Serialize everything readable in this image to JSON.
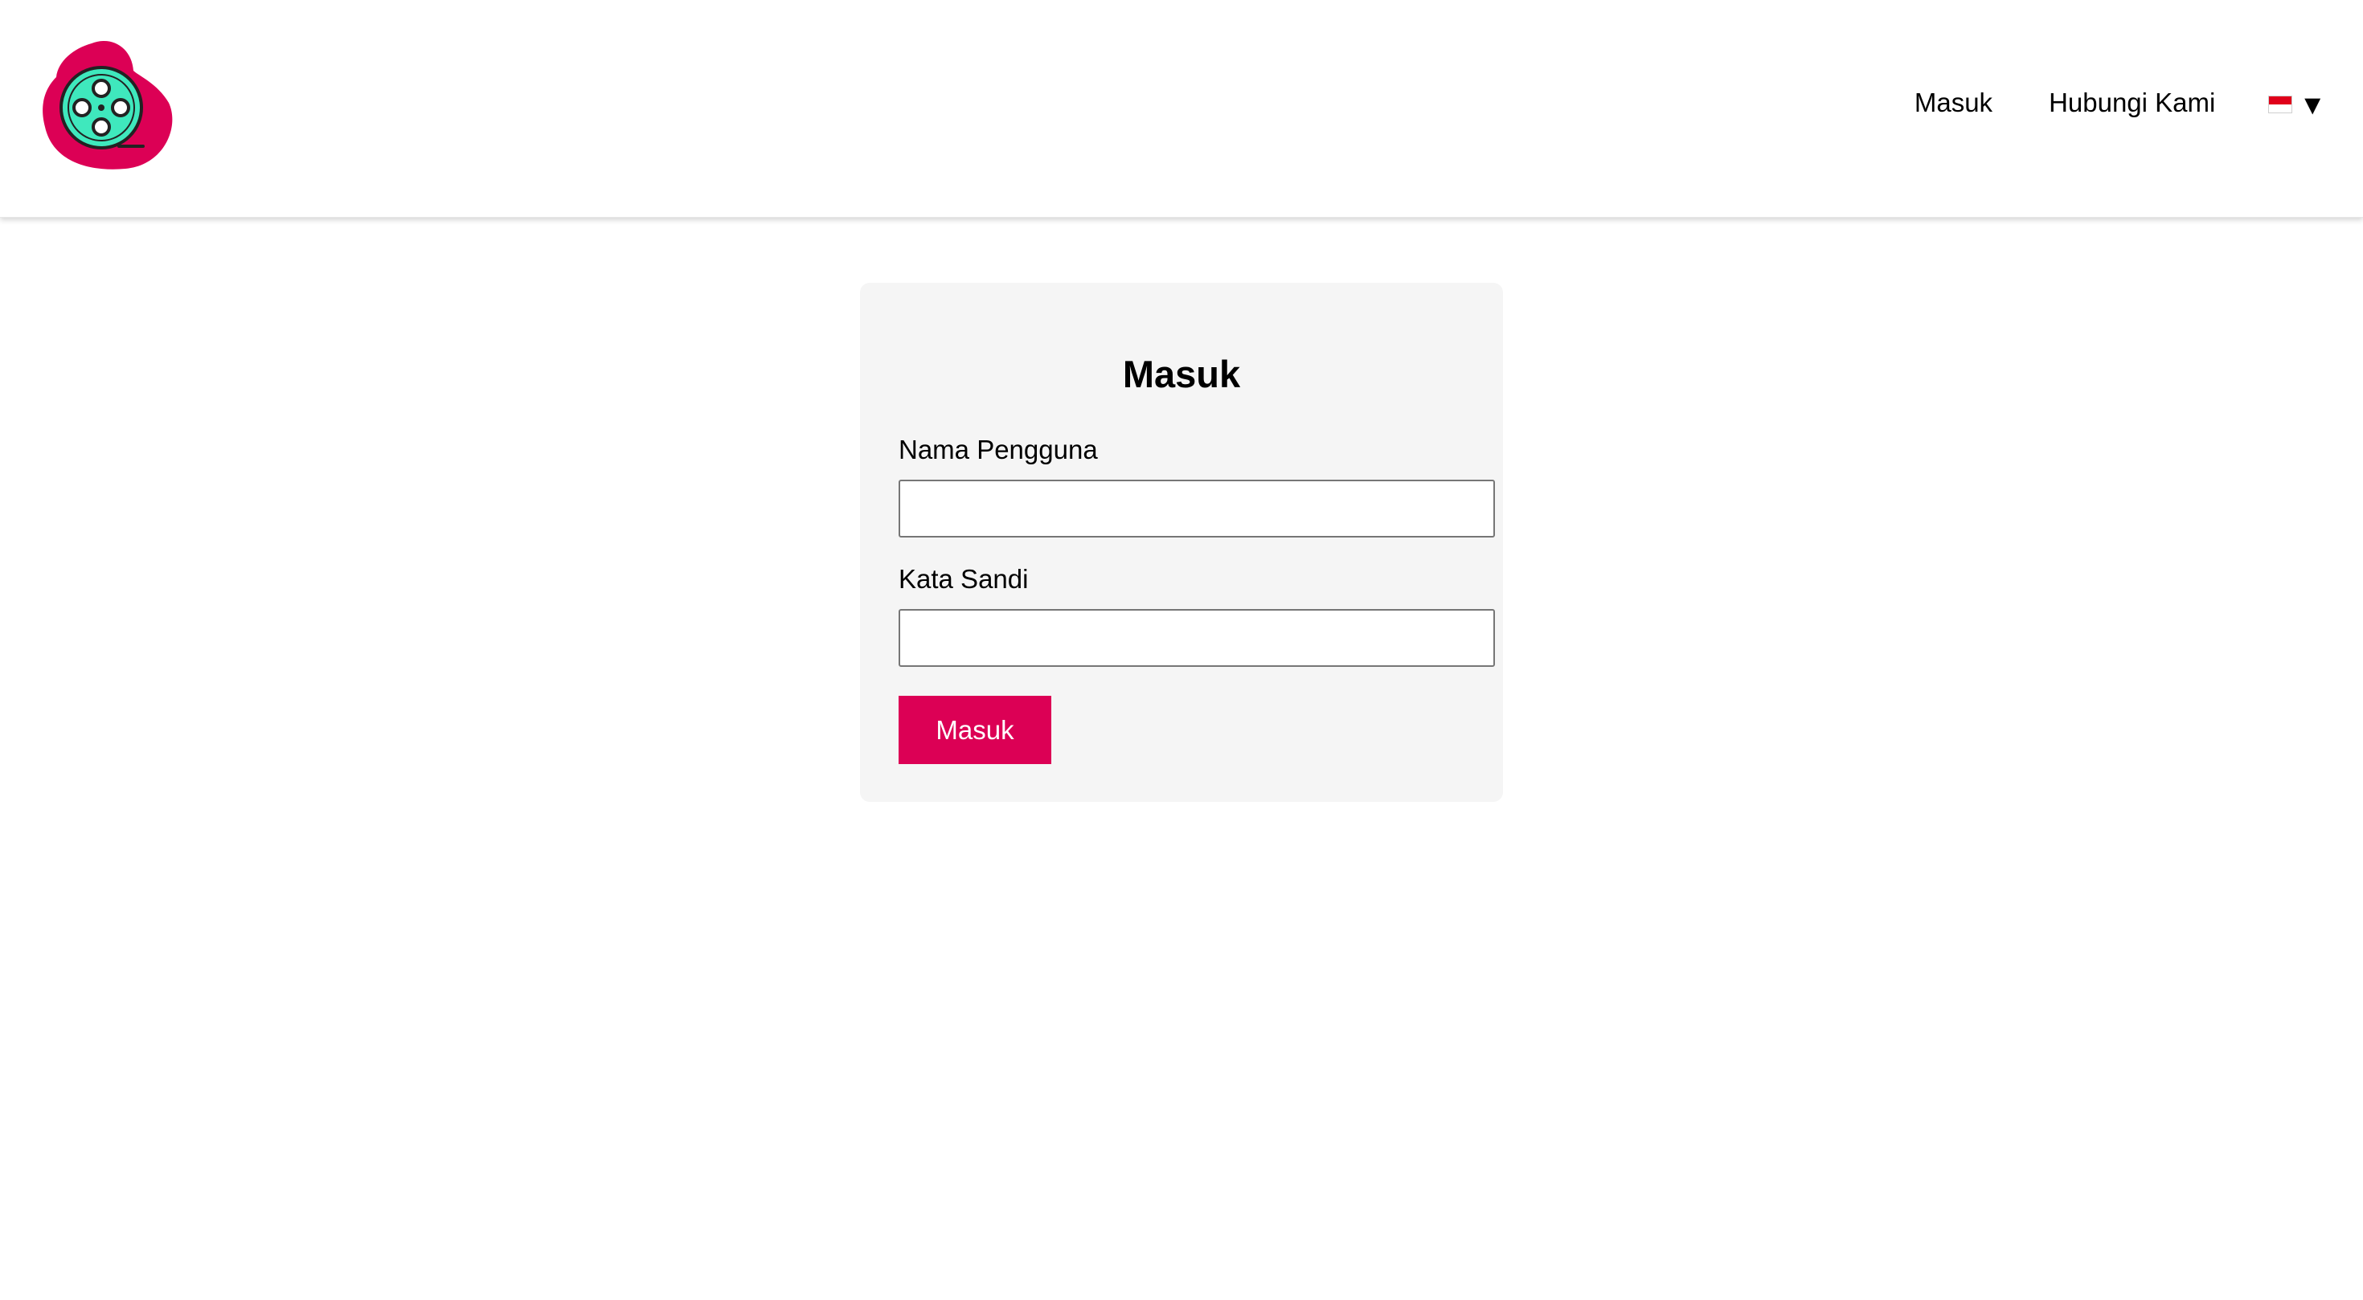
{
  "brand": {
    "logo_icon": "film-reel-logo-icon",
    "primary_color": "#dc0055",
    "accent_color": "#3fe8bd"
  },
  "nav": {
    "login_label": "Masuk",
    "contact_label": "Hubungi Kami",
    "language": {
      "flag_icon": "indonesia-flag-icon",
      "caret_icon": "caret-down-icon",
      "caret_glyph": "▼"
    }
  },
  "login_form": {
    "title": "Masuk",
    "username": {
      "label": "Nama Pengguna",
      "value": "",
      "placeholder": ""
    },
    "password": {
      "label": "Kata Sandi",
      "value": "",
      "placeholder": ""
    },
    "submit_label": "Masuk"
  }
}
